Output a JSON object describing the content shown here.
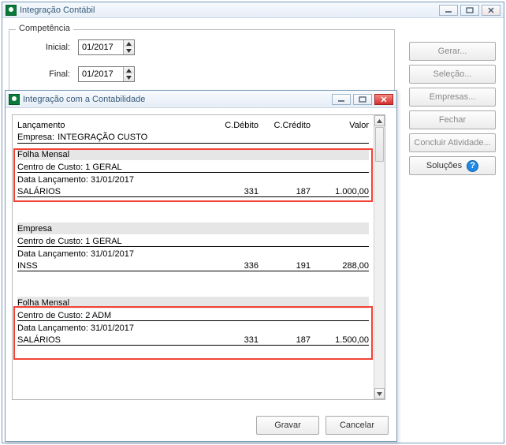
{
  "main_window": {
    "title": "Integração Contábil",
    "competencia": {
      "legend": "Competência",
      "inicial_label": "Inicial:",
      "inicial_value": "01/2017",
      "final_label": "Final:",
      "final_value": "01/2017"
    },
    "buttons": {
      "gerar": "Gerar...",
      "selecao": "Seleção...",
      "empresas": "Empresas...",
      "fechar": "Fechar",
      "concluir": "Concluir Atividade...",
      "solucoes": "Soluções"
    }
  },
  "dialog": {
    "title": "Integração com a Contabilidade",
    "columns": {
      "lanc": "Lançamento",
      "deb": "C.Débito",
      "cred": "C.Crédito",
      "val": "Valor"
    },
    "empresa_label": "Empresa:",
    "empresa_name": "INTEGRAÇÃO CUSTO",
    "empresa_only_label": "Empresa",
    "groups": [
      {
        "folha": "Folha Mensal",
        "centro": "Centro de Custo: 1 GERAL",
        "data_lanc": "Data Lançamento: 31/01/2017",
        "descr": "SALÁRIOS",
        "deb": "331",
        "cred": "187",
        "val": "1.000,00"
      },
      {
        "folha": "",
        "centro": "Centro de Custo: 1 GERAL",
        "data_lanc": "Data Lançamento: 31/01/2017",
        "descr": "INSS",
        "deb": "336",
        "cred": "191",
        "val": "288,00"
      },
      {
        "folha": "Folha Mensal",
        "centro": "Centro de Custo: 2 ADM",
        "data_lanc": "Data Lançamento: 31/01/2017",
        "descr": "SALÁRIOS",
        "deb": "331",
        "cred": "187",
        "val": "1.500,00"
      }
    ],
    "buttons": {
      "gravar": "Gravar",
      "cancelar": "Cancelar"
    }
  }
}
